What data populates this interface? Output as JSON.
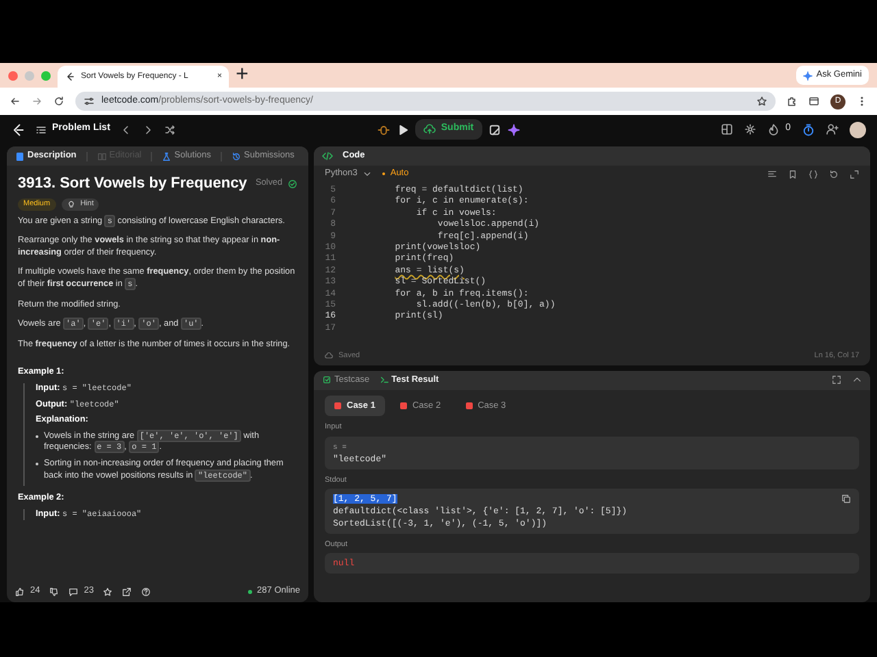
{
  "browser": {
    "tab_title": "Sort Vowels by Frequency - L",
    "tab_close": "×",
    "new_tab": "+",
    "ask_gemini": "Ask Gemini",
    "url_domain": "leetcode.com",
    "url_path": "/problems/sort-vowels-by-frequency/",
    "profile_initial": "D"
  },
  "nav": {
    "problem_list": "Problem List",
    "submit": "Submit",
    "streak": "0"
  },
  "description": {
    "tabs": [
      {
        "label": "Description",
        "selected": true,
        "disabled": false
      },
      {
        "label": "Editorial",
        "selected": false,
        "disabled": true
      },
      {
        "label": "Solutions",
        "selected": false,
        "disabled": false
      },
      {
        "label": "Submissions",
        "selected": false,
        "disabled": false
      }
    ],
    "title": "3913. Sort Vowels by Frequency",
    "status": "Solved",
    "difficulty": "Medium",
    "hint": "Hint",
    "paragraphs": [
      [
        {
          "kind": "text",
          "text": "You are given a string "
        },
        {
          "kind": "code",
          "text": "s"
        },
        {
          "kind": "text",
          "text": " consisting of lowercase English characters."
        }
      ],
      [
        {
          "kind": "text",
          "text": "Rearrange only the **vowels** in the string so that they appear in **non-increasing** order of their frequency."
        }
      ],
      [
        {
          "kind": "text",
          "text": "If multiple vowels have the same **frequency**, order them by the position of their **first occurrence** in "
        },
        {
          "kind": "code",
          "text": "s"
        },
        {
          "kind": "text",
          "text": "."
        }
      ],
      [
        {
          "kind": "text",
          "text": "Return the modified string."
        }
      ],
      [
        {
          "kind": "text",
          "text": "Vowels are "
        },
        {
          "kind": "code",
          "text": "'a'"
        },
        {
          "kind": "text",
          "text": ", "
        },
        {
          "kind": "code",
          "text": "'e'"
        },
        {
          "kind": "text",
          "text": ", "
        },
        {
          "kind": "code",
          "text": "'i'"
        },
        {
          "kind": "text",
          "text": ", "
        },
        {
          "kind": "code",
          "text": "'o'"
        },
        {
          "kind": "text",
          "text": ", and "
        },
        {
          "kind": "code",
          "text": "'u'"
        },
        {
          "kind": "text",
          "text": "."
        }
      ],
      [
        {
          "kind": "text",
          "text": "The **frequency** of a letter is the number of times it occurs in the string."
        }
      ]
    ],
    "examples": [
      {
        "title": "Example 1:",
        "items": [
          {
            "kind": "line",
            "segments": [
              {
                "kind": "label",
                "text": "Input: "
              },
              {
                "kind": "mono",
                "text": "s = \"leetcode\""
              }
            ]
          },
          {
            "kind": "line",
            "segments": [
              {
                "kind": "label",
                "text": "Output: "
              },
              {
                "kind": "mono",
                "text": "\"leetcode\""
              }
            ]
          },
          {
            "kind": "line",
            "segments": [
              {
                "kind": "label",
                "text": "Explanation:"
              }
            ]
          },
          {
            "kind": "bullet",
            "segments": [
              {
                "kind": "text",
                "text": "Vowels in the string are "
              },
              {
                "kind": "code",
                "text": "['e', 'e', 'o', 'e']"
              },
              {
                "kind": "text",
                "text": " with frequencies: "
              },
              {
                "kind": "code",
                "text": "e = 3"
              },
              {
                "kind": "text",
                "text": ", "
              },
              {
                "kind": "code",
                "text": "o = 1"
              },
              {
                "kind": "text",
                "text": "."
              }
            ]
          },
          {
            "kind": "bullet",
            "segments": [
              {
                "kind": "text",
                "text": "Sorting in non-increasing order of frequency and placing them back into the vowel positions results in "
              },
              {
                "kind": "code",
                "text": "\"leetcode\""
              },
              {
                "kind": "text",
                "text": "."
              }
            ]
          }
        ]
      },
      {
        "title": "Example 2:",
        "items": [
          {
            "kind": "line",
            "segments": [
              {
                "kind": "label",
                "text": "Input: "
              },
              {
                "kind": "mono",
                "text": "s = \"aeiaaioooa\""
              }
            ]
          }
        ]
      }
    ],
    "footer": {
      "likes": "24",
      "comments": "23",
      "online": "287 Online"
    }
  },
  "code_panel": {
    "title": "Code",
    "language": "Python3",
    "mode": "Auto",
    "lines": [
      {
        "number": "5",
        "text": "        freq = defaultdict(list)",
        "current": false,
        "warning": false
      },
      {
        "number": "6",
        "text": "        for i, c in enumerate(s):",
        "current": false,
        "warning": false
      },
      {
        "number": "7",
        "text": "            if c in vowels:",
        "current": false,
        "warning": false
      },
      {
        "number": "8",
        "text": "                vowelsloc.append(i)",
        "current": false,
        "warning": false
      },
      {
        "number": "9",
        "text": "                freq[c].append(i)",
        "current": false,
        "warning": false
      },
      {
        "number": "10",
        "text": "        print(vowelsloc)",
        "current": false,
        "warning": false
      },
      {
        "number": "11",
        "text": "        print(freq)",
        "current": false,
        "warning": false
      },
      {
        "number": "12",
        "text": "        ans = list(s)",
        "current": false,
        "warning": true
      },
      {
        "number": "13",
        "text": "        sl = SortedList()",
        "current": false,
        "warning": false
      },
      {
        "number": "14",
        "text": "        for a, b in freq.items():",
        "current": false,
        "warning": false
      },
      {
        "number": "15",
        "text": "            sl.add((-len(b), b[0], a))",
        "current": false,
        "warning": false
      },
      {
        "number": "16",
        "text": "        print(sl)",
        "current": true,
        "warning": false
      },
      {
        "number": "17",
        "current": false
      }
    ],
    "saved": "Saved",
    "cursor": "Ln 16, Col 17"
  },
  "test_panel": {
    "tabs": [
      {
        "label": "Testcase",
        "selected": false
      },
      {
        "label": "Test Result",
        "selected": true
      }
    ],
    "cases": [
      {
        "label": "Case 1",
        "selected": true,
        "passed": false
      },
      {
        "label": "Case 2",
        "selected": false,
        "passed": false
      },
      {
        "label": "Case 3",
        "selected": false,
        "passed": false
      }
    ],
    "input_label": "Input",
    "input_var": "s =",
    "input_value": "\"leetcode\"",
    "stdout_label": "Stdout",
    "stdout_lines": [
      {
        "text": "[1, 2, 5, 7]",
        "selected": true
      },
      {
        "text": "defaultdict(<class 'list'>, {'e': [1, 2, 7], 'o': [5]})",
        "selected": false
      },
      {
        "text": "SortedList([(-3, 1, 'e'), (-1, 5, 'o')])",
        "selected": false
      }
    ],
    "output_label": "Output",
    "output_value": "null"
  }
}
